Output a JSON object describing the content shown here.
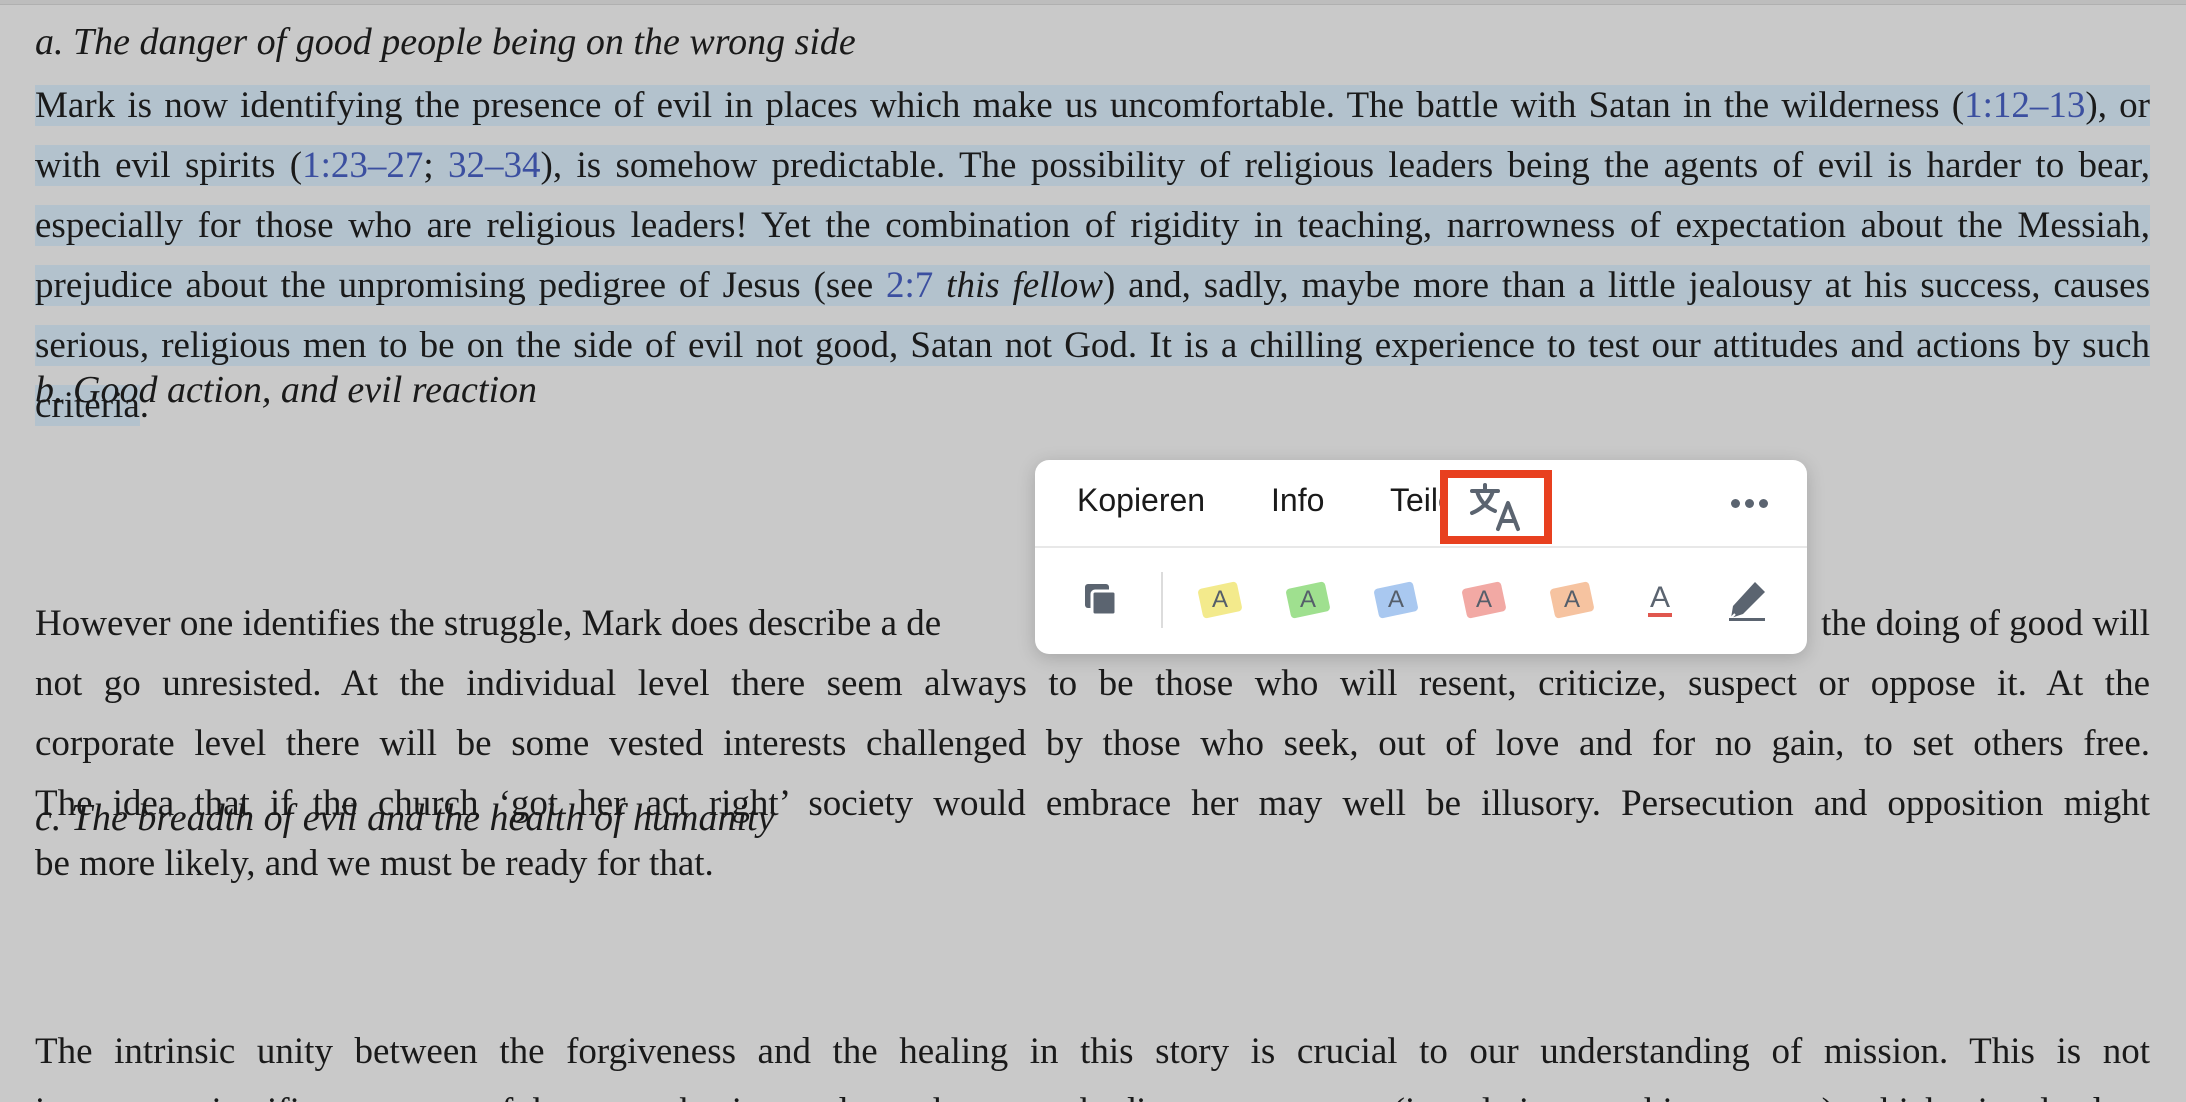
{
  "sections": {
    "a": {
      "heading": "a.  The danger of good people being on the wrong side",
      "p_lines": [
        [
          "Mark is now identifying the presence of evil in places which make us uncomfortable. The battle with Satan in the wilderness"
        ],
        [
          "(",
          "1:12–13",
          "), or with evil spirits (",
          "1:23–27",
          "; ",
          "32–34",
          "), is somehow predictable. The possibility of religious leaders being the agents of"
        ],
        [
          "evil is harder to bear, especially for those who are religious leaders! Yet the combination of rigidity in teaching, narrowness of"
        ],
        [
          "expectation about the Messiah, prejudice about the unpromising pedigree of Jesus (see ",
          "2:7",
          " this fellow",
          ") and, sadly, maybe more"
        ],
        [
          "than a little jealousy at his success, causes serious, religious men to be on the side of evil not good, Satan not God. It is a chilling"
        ],
        [
          "experience to test our attitudes and actions by such criteria",
          "."
        ]
      ]
    },
    "b": {
      "heading": "b.  Good action, and evil reaction",
      "line1_left": "However one identifies the struggle, Mark does describe a de",
      "line1_right": "the doing of good will",
      "rest": [
        "not go unresisted. At the individual level there seem always to be those who will resent, criticize, suspect or oppose it. At the",
        "corporate level there will be some vested interests challenged by those who seek, out of love and for no gain, to set others free.",
        "The idea that if the church ‘got her act right’ society would embrace her may well be illusory. Persecution and opposition might",
        "be more likely, and we must be ready for that."
      ]
    },
    "c": {
      "heading": "c.  The breadth of evil and the health of humanity",
      "line1": "The intrinsic unity between the forgiveness and the healing in this story is crucial to our understanding of mission. This is not",
      "line2": "in some scientific category of how much sin produces how much disease, or even (in relation to this passage) which sins lead to"
    }
  },
  "popup": {
    "copy_label": "Kopieren",
    "info_label": "Info",
    "share_label": "Teilen",
    "translate_icon": "translate-icon",
    "more_icon": "ellipsis-icon",
    "tools": [
      {
        "name": "copy-icon"
      },
      {
        "name": "highlight-yellow",
        "letter": "A",
        "color": "#f3ea8c"
      },
      {
        "name": "highlight-green",
        "letter": "A",
        "color": "#9fe08f"
      },
      {
        "name": "highlight-blue",
        "letter": "A",
        "color": "#a9c8f0"
      },
      {
        "name": "highlight-red",
        "letter": "A",
        "color": "#f2a9a4"
      },
      {
        "name": "highlight-orange",
        "letter": "A",
        "color": "#f6c3a0"
      },
      {
        "name": "underline-icon",
        "letter": "A",
        "color": "#e0574e"
      },
      {
        "name": "pen-icon"
      }
    ]
  },
  "colors": {
    "background": "#c9c9c9",
    "selection": "#b3c2cd",
    "link": "#3b4fa0",
    "translate_highlight_border": "#e8401f"
  }
}
